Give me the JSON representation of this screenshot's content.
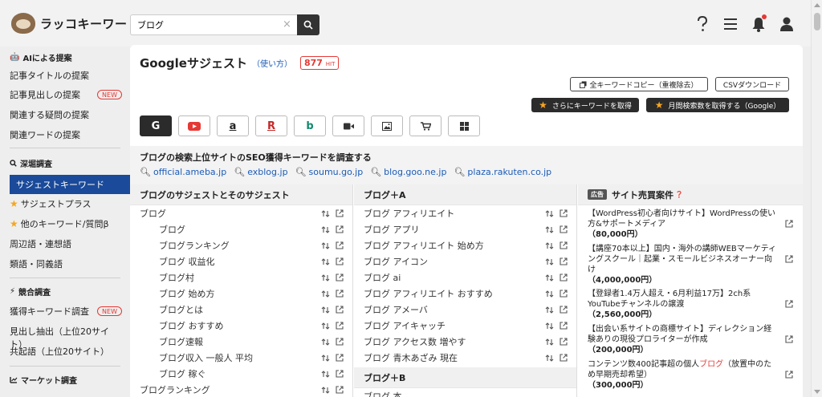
{
  "app": {
    "name": "ラッコキーワード"
  },
  "search": {
    "value": "ブログ",
    "clear": "×"
  },
  "sidebar": {
    "ai_head": "AIによる提案",
    "ai_items": [
      "記事タイトルの提案",
      "記事見出しの提案",
      "関連する疑問の提案",
      "関連ワードの提案"
    ],
    "new_badge": "NEW",
    "deep_head": "深堀調査",
    "deep_active": "サジェストキーワード",
    "deep_items": [
      "サジェストプラス",
      "他のキーワード/質問β",
      "周辺語・連想語",
      "類語・同義語"
    ],
    "comp_head": "競合調査",
    "comp_items": [
      "獲得キーワード調査",
      "見出し抽出（上位20サイト）",
      "共起語（上位20サイト）"
    ],
    "market_head": "マーケット調査"
  },
  "main": {
    "title": "Googleサジェスト",
    "usage": "（使い方）",
    "hit_count": "877",
    "hit_unit": "HIT",
    "copy_all": "全キーワードコピー（重複除去）",
    "csv": "CSVダウンロード",
    "more_keywords": "さらにキーワードを取得",
    "monthly_volume": "月間検索数を取得する（Google）",
    "seo_title": "ブログの検索上位サイトのSEO獲得キーワードを調査する",
    "seo_links": [
      "official.ameba.jp",
      "exblog.jp",
      "soumu.go.jp",
      "blog.goo.ne.jp",
      "plaza.rakuten.co.jp"
    ],
    "col1": {
      "head": "ブログのサジェストとそのサジェスト",
      "rows": [
        {
          "text": "ブログ",
          "indent": false
        },
        {
          "text": "ブログ",
          "indent": true
        },
        {
          "text": "ブログランキング",
          "indent": true
        },
        {
          "text": "ブログ 収益化",
          "indent": true
        },
        {
          "text": "ブログ村",
          "indent": true
        },
        {
          "text": "ブログ 始め方",
          "indent": true
        },
        {
          "text": "ブログとは",
          "indent": true
        },
        {
          "text": "ブログ おすすめ",
          "indent": true
        },
        {
          "text": "ブログ速報",
          "indent": true
        },
        {
          "text": "ブログ収入 一般人 平均",
          "indent": true
        },
        {
          "text": "ブログ 稼ぐ",
          "indent": true
        },
        {
          "text": "ブログランキング",
          "indent": false
        }
      ]
    },
    "col2": {
      "head": "ブログ＋A",
      "rows": [
        "ブログ アフィリエイト",
        "ブログ アプリ",
        "ブログ アフィリエイト 始め方",
        "ブログ アイコン",
        "ブログ ai",
        "ブログ アフィリエイト おすすめ",
        "ブログ アメーバ",
        "ブログ アイキャッチ",
        "ブログ アクセス数 増やす",
        "ブログ 青木あざみ 現在"
      ],
      "head2": "ブログ＋B",
      "row2": "ブログ 本"
    },
    "col3": {
      "tag": "広告",
      "head": "サイト売買案件",
      "items": [
        {
          "text": "【WordPress初心者向けサイト】WordPressの使い方&サポートメディア",
          "price": "（80,000円）"
        },
        {
          "text": "【講座70本以上】国内・海外の講師WEBマーケティングスクール｜起業・スモールビジネスオーナー向け",
          "price": "（4,000,000円）"
        },
        {
          "text": "【登録者1.4万人超え・6月利益17万】2ch系YouTubeチャンネルの譲渡",
          "price": "（2,560,000円）"
        },
        {
          "text": "【出会い系サイトの商標サイト】ディレクション経験ありの現役プロライターが作成",
          "price": "（200,000円）"
        },
        {
          "text_a": "コンテンツ数400記事超の個人",
          "text_hl": "ブログ",
          "text_b": "（放置中のため早期売却希望）",
          "price": "（300,000円）"
        }
      ]
    }
  }
}
